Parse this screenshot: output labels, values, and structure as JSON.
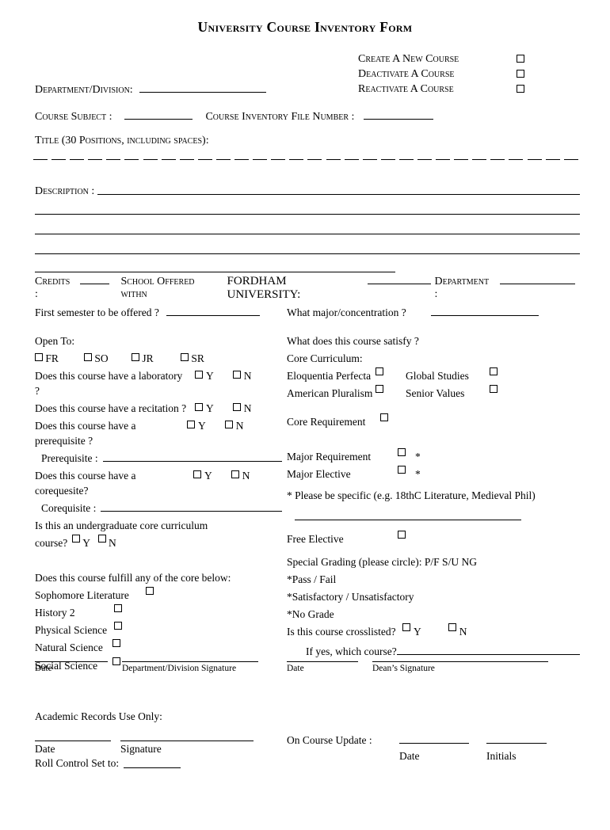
{
  "title": "University Course Inventory Form",
  "actions": [
    {
      "label": "Create A New Course"
    },
    {
      "label": "Deactivate A Course"
    },
    {
      "label": "Reactivate A Course"
    }
  ],
  "department_division_label": "Department/Division:",
  "course_subject_label": "Course  Subject :",
  "course_inventory_file_label": "Course Inventory File Number :",
  "title_positions_label": "Title (30  Positions, including spaces):",
  "description_label": "Description :",
  "credits": {
    "credits_label": "Credits :",
    "school_label": "School Offered withn",
    "university": "FORDHAM UNIVERSITY:",
    "department_label": "Department :"
  },
  "left": {
    "first_semester": "First semester to be offered ?",
    "open_to_label": "Open To:",
    "open_to_options": [
      "FR",
      "SO",
      "JR",
      "SR"
    ],
    "laboratory": "Does this course have a laboratory ?",
    "recitation": "Does this course have a recitation ?",
    "prerequisite": "Does this course have a prerequisite ?",
    "prerequisite_field": "Prerequisite :",
    "corequisite": "Does this course have a corequesite?",
    "corequisite_field": "Corequisite :",
    "undergrad_core_1": "Is this an undergraduate core curriculum",
    "undergrad_core_2": "course?",
    "y": "Y",
    "n": "N",
    "fulfill_core": "Does this course fulfill any of the core below:",
    "core_items": [
      "Sophomore Literature",
      "History 2",
      "Physical Science",
      "Natural Science",
      "Social Science"
    ]
  },
  "right": {
    "major_concentration": "What major/concentration ?",
    "satisfy": "What does this course satisfy ?",
    "core_curriculum": "Core Curriculum:",
    "core_pairs": [
      {
        "left": "Eloquentia Perfecta",
        "right": "Global Studies"
      },
      {
        "left": "American Pluralism",
        "right": "Senior Values"
      }
    ],
    "core_requirement": "Core Requirement",
    "major_requirement": "Major Requirement",
    "major_elective": "Major Elective",
    "asterisk": "*",
    "specific_note": "* Please be specific (e.g. 18thC Literature, Medieval Phil)",
    "free_elective": "Free Elective",
    "special_grading": "Special  Grading (please circle):   P/F  S/U  NG",
    "grading_notes": [
      "*Pass / Fail",
      "*Satisfactory / Unsatisfactory",
      "*No Grade"
    ],
    "crosslisted": "Is this course crosslisted?",
    "y": "Y",
    "n": "N",
    "if_yes": "If yes, which course?"
  },
  "signatures": {
    "date_left": "Date",
    "dept_signature": "Department/Division Signature",
    "date_right": "Date",
    "dean_signature": "Dean’s Signature"
  },
  "academic": {
    "heading": "Academic Records Use Only:",
    "date": "Date",
    "signature": "Signature",
    "roll_control": "Roll Control Set to:",
    "on_course_update": "On Course Update :",
    "date2": "Date",
    "initials": "Initials"
  }
}
